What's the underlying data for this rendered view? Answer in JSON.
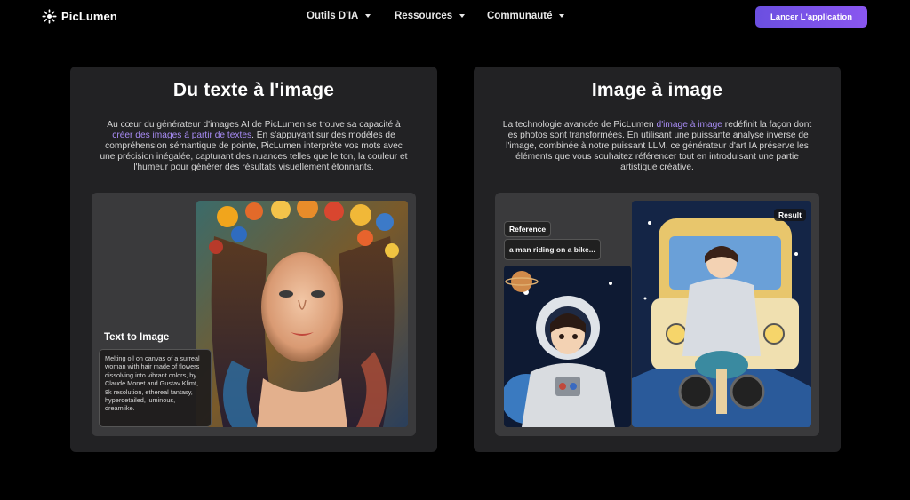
{
  "nav": {
    "brand": "PicLumen",
    "menu": [
      {
        "label": "Outils D'IA"
      },
      {
        "label": "Ressources"
      },
      {
        "label": "Communauté"
      }
    ],
    "cta_label": "Lancer L'application"
  },
  "cards": [
    {
      "title": "Du texte à l'image",
      "desc_before": "Au cœur du générateur d'images AI de PicLumen se trouve sa capacité à ",
      "desc_link": "créer des images à partir de textes",
      "desc_after": ". En s'appuyant sur des modèles de compréhension sémantique de pointe, PicLumen interprète vos mots avec une précision inégalée, capturant des nuances telles que le ton, la couleur et l'humeur pour générer des résultats visuellement étonnants.",
      "panel_label": "Text to Image",
      "prompt_text": "Melting oil on canvas of a surreal woman with hair made of flowers dissolving into vibrant colors, by Claude Monet and Gustav Klimt, 8k resolution, ethereal fantasy, hyperdetailed, luminous, dreamlike."
    },
    {
      "title": "Image à image",
      "desc_before": "La technologie avancée de PicLumen ",
      "desc_link": "d'image à image",
      "desc_after": " redéfinit la façon dont les photos sont transformées. En utilisant une puissante analyse inverse de l'image, combinée à notre puissant LLM, ce générateur d'art IA préserve les éléments que vous souhaitez référencer tout en introduisant une partie artistique créative.",
      "reference_label": "Reference",
      "reference_prompt": "a man riding on a bike...",
      "result_label": "Result"
    }
  ],
  "colors": {
    "accent": "#7c55ee",
    "link": "#a88cf5",
    "card_bg": "#222224"
  }
}
